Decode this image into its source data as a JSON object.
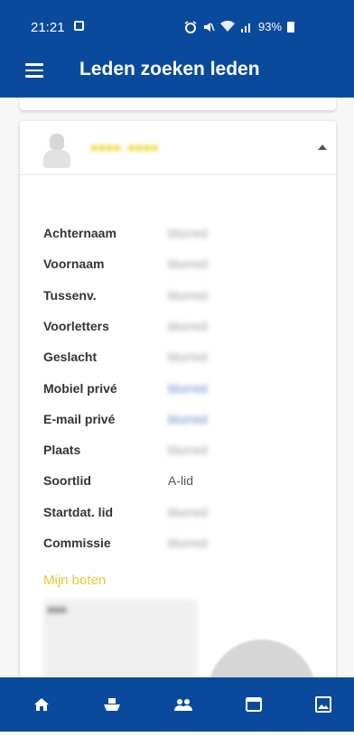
{
  "status_bar": {
    "time": "21:21",
    "battery": "93%"
  },
  "app_bar": {
    "title": "Leden zoeken leden"
  },
  "member": {
    "name": "(blurred)",
    "fields": [
      {
        "label": "Achternaam",
        "value": "blurred",
        "kind": "text"
      },
      {
        "label": "Voornaam",
        "value": "blurred",
        "kind": "text"
      },
      {
        "label": "Tussenv.",
        "value": "blurred",
        "kind": "text"
      },
      {
        "label": "Voorletters",
        "value": "blurred",
        "kind": "text"
      },
      {
        "label": "Geslacht",
        "value": "blurred",
        "kind": "text"
      },
      {
        "label": "Mobiel privé",
        "value": "blurred",
        "kind": "link"
      },
      {
        "label": "E-mail privé",
        "value": "blurred",
        "kind": "link"
      },
      {
        "label": "Plaats",
        "value": "blurred",
        "kind": "text"
      },
      {
        "label": "Soortlid",
        "value": "A-lid",
        "kind": "plain"
      },
      {
        "label": "Startdat. lid",
        "value": "blurred",
        "kind": "text"
      },
      {
        "label": "Commissie",
        "value": "blurred",
        "kind": "text"
      }
    ]
  },
  "boats_section": {
    "title": "Mijn boten"
  },
  "bottom_nav": [
    {
      "icon": "home-icon"
    },
    {
      "icon": "boat-icon"
    },
    {
      "icon": "members-icon"
    },
    {
      "icon": "calendar-icon"
    },
    {
      "icon": "gallery-icon"
    }
  ],
  "colors": {
    "primary": "#0a4a9c",
    "accent": "#e8c637"
  }
}
